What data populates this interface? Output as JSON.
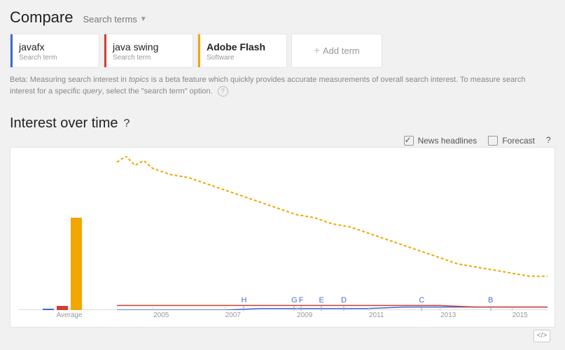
{
  "header": {
    "title": "Compare",
    "subselect": "Search terms"
  },
  "terms": [
    {
      "name": "javafx",
      "type": "Search term",
      "color": "#3f67d8"
    },
    {
      "name": "java swing",
      "type": "Search term",
      "color": "#d23f31"
    },
    {
      "name": "Adobe Flash",
      "type": "Software",
      "color": "#f2a600"
    }
  ],
  "add_term_label": "Add term",
  "beta_text_1": "Beta: Measuring search interest in ",
  "beta_topics": "topics",
  "beta_text_2": " is a beta feature which quickly provides accurate measurements of overall search interest. To measure search interest for a specific ",
  "beta_query": "query",
  "beta_text_3": ", select the \"search term\" option.",
  "section": {
    "title": "Interest over time"
  },
  "options": {
    "news_headlines": {
      "label": "News headlines",
      "checked": true
    },
    "forecast": {
      "label": "Forecast",
      "checked": false
    }
  },
  "average_label": "Average",
  "embed_label": "</>",
  "news_markers": [
    {
      "letter": "H",
      "x": 0.295
    },
    {
      "letter": "G",
      "x": 0.412
    },
    {
      "letter": "F",
      "x": 0.428
    },
    {
      "letter": "E",
      "x": 0.475
    },
    {
      "letter": "D",
      "x": 0.527
    },
    {
      "letter": "C",
      "x": 0.708
    },
    {
      "letter": "B",
      "x": 0.868
    }
  ],
  "chart_data": {
    "type": "line",
    "title": "Interest over time",
    "xlabel": "",
    "ylabel": "",
    "ylim": [
      0,
      100
    ],
    "x_ticks": [
      "2005",
      "2007",
      "2009",
      "2011",
      "2013",
      "2015"
    ],
    "averages": {
      "javafx": 1,
      "java swing": 3,
      "Adobe Flash": 60
    },
    "series": [
      {
        "name": "javafx",
        "color": "#3f67d8",
        "x": [
          2004,
          2005,
          2006,
          2007,
          2008,
          2009,
          2010,
          2011,
          2012,
          2013,
          2014,
          2015,
          2016
        ],
        "y": [
          0,
          0,
          0,
          0,
          1,
          1,
          1,
          1,
          2,
          2,
          2,
          2,
          2
        ]
      },
      {
        "name": "java swing",
        "color": "#d23f31",
        "x": [
          2004,
          2005,
          2006,
          2007,
          2008,
          2009,
          2010,
          2011,
          2012,
          2013,
          2014,
          2015,
          2016
        ],
        "y": [
          3,
          3,
          3,
          3,
          3,
          3,
          3,
          3,
          3,
          3,
          2,
          2,
          2
        ]
      },
      {
        "name": "Adobe Flash",
        "color": "#f2a600",
        "x": [
          2004,
          2004.25,
          2004.5,
          2004.75,
          2005,
          2005.5,
          2006,
          2006.5,
          2007,
          2007.5,
          2008,
          2008.5,
          2009,
          2009.5,
          2010,
          2010.5,
          2011,
          2011.5,
          2012,
          2012.5,
          2013,
          2013.5,
          2014,
          2014.5,
          2015,
          2015.5,
          2016
        ],
        "y": [
          96,
          100,
          94,
          97,
          92,
          88,
          86,
          82,
          78,
          74,
          70,
          66,
          62,
          60,
          56,
          54,
          50,
          46,
          42,
          38,
          34,
          30,
          28,
          26,
          24,
          22,
          22
        ]
      }
    ]
  }
}
